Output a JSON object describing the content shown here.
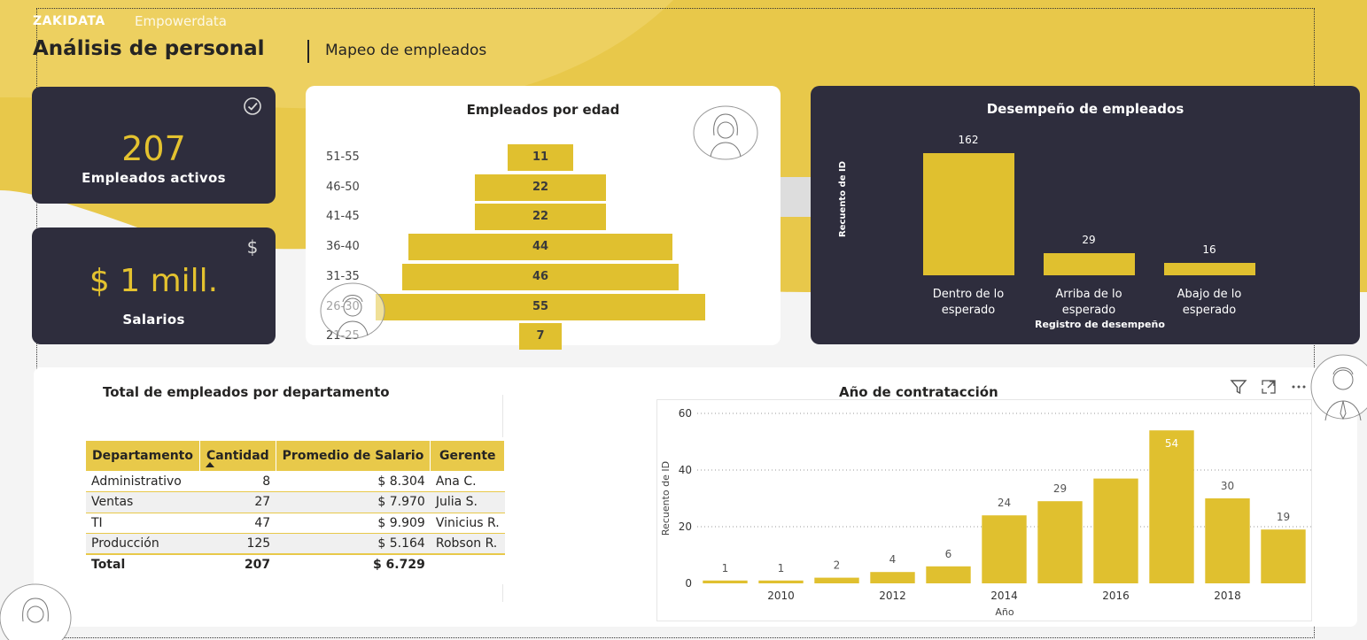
{
  "header": {
    "brand": "ZAKIDATA",
    "brand_sub": "Empowerdata",
    "title": "Análisis de personal",
    "subtitle": "Mapeo de empleados"
  },
  "kpis": {
    "active": {
      "value": "207",
      "label": "Empleados activos",
      "icon": "check-circle-icon"
    },
    "salaries": {
      "value": "$ 1 mill.",
      "label": "Salarios",
      "icon": "dollar-icon"
    }
  },
  "colors": {
    "accent": "#e0c02f",
    "dark": "#2e2d3d",
    "table_header": "#e8c94a"
  },
  "age_chart": {
    "title": "Empleados por edad",
    "type": "bar",
    "categories": [
      "51-55",
      "46-50",
      "41-45",
      "36-40",
      "31-35",
      "26-30",
      "21-25"
    ],
    "values": [
      11,
      22,
      22,
      44,
      46,
      55,
      7
    ]
  },
  "perf_chart": {
    "title": "Desempeño de empleados",
    "type": "bar",
    "categories": [
      "Dentro de lo esperado",
      "Arriba de lo esperado",
      "Abajo de lo esperado"
    ],
    "values": [
      162,
      29,
      16
    ],
    "ylabel": "Recuento de ID",
    "xlabel": "Registro de desempeño"
  },
  "dept_table": {
    "title": "Total de empleados por departamento",
    "columns": [
      "Departamento",
      "Cantidad",
      "Promedio de Salario",
      "Gerente"
    ],
    "rows": [
      [
        "Administrativo",
        "8",
        "$ 8.304",
        "Ana C."
      ],
      [
        "Ventas",
        "27",
        "$ 7.970",
        "Julia S."
      ],
      [
        "TI",
        "47",
        "$ 9.909",
        "Vinicius R."
      ],
      [
        "Producción",
        "125",
        "$ 5.164",
        "Robson R."
      ]
    ],
    "total": [
      "Total",
      "207",
      "$ 6.729",
      ""
    ]
  },
  "chart_data": {
    "type": "bar",
    "title": "Año de contratacción",
    "xlabel": "Año",
    "ylabel": "Recuento de ID",
    "x": [
      2009,
      2010,
      2011,
      2012,
      2013,
      2014,
      2015,
      2016,
      2017,
      2018,
      2019
    ],
    "values": [
      1,
      1,
      2,
      4,
      6,
      24,
      29,
      37,
      54,
      30,
      19
    ],
    "labels": [
      "1",
      "1",
      "2",
      "4",
      "6",
      "24",
      "29",
      "",
      "54",
      "30",
      "19"
    ],
    "x_ticks": [
      "2010",
      "2012",
      "2014",
      "2016",
      "2018"
    ],
    "y_ticks": [
      "0",
      "20",
      "40",
      "60"
    ],
    "ylim": [
      0,
      60
    ],
    "grid": true
  },
  "visual_icons": [
    "filter-icon",
    "focus-mode-icon",
    "more-options-icon"
  ]
}
